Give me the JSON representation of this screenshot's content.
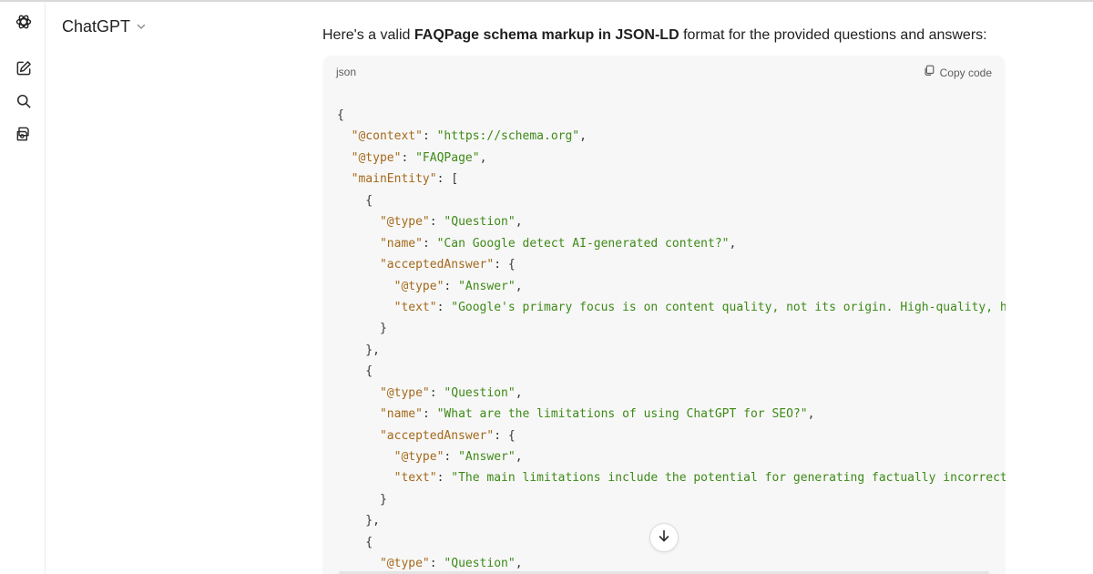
{
  "colors": {
    "key": "#a4691b",
    "string": "#3e8a17",
    "punctuation": "#383838",
    "code_background": "#f7f7f7"
  },
  "sidebar": {
    "items": [
      {
        "icon": "chatgpt-logo-icon"
      },
      {
        "icon": "new-chat-icon"
      },
      {
        "icon": "search-icon"
      },
      {
        "icon": "explore-gpts-icon"
      }
    ]
  },
  "header": {
    "model_name": "ChatGPT",
    "dropdown_icon": "chevron-down-icon"
  },
  "message": {
    "intro_prefix": "Here's a valid ",
    "intro_bold": "FAQPage schema markup in JSON-LD",
    "intro_suffix": " format for the provided questions and answers:"
  },
  "code_block": {
    "language": "json",
    "copy_label": "Copy code",
    "copy_icon": "copy-icon",
    "lines": [
      [
        [
          "p",
          "{"
        ]
      ],
      [
        [
          "p",
          "  "
        ],
        [
          "k",
          "\"@context\""
        ],
        [
          "p",
          ": "
        ],
        [
          "s",
          "\"https://schema.org\""
        ],
        [
          "p",
          ","
        ]
      ],
      [
        [
          "p",
          "  "
        ],
        [
          "k",
          "\"@type\""
        ],
        [
          "p",
          ": "
        ],
        [
          "s",
          "\"FAQPage\""
        ],
        [
          "p",
          ","
        ]
      ],
      [
        [
          "p",
          "  "
        ],
        [
          "k",
          "\"mainEntity\""
        ],
        [
          "p",
          ": ["
        ]
      ],
      [
        [
          "p",
          "    {"
        ]
      ],
      [
        [
          "p",
          "      "
        ],
        [
          "k",
          "\"@type\""
        ],
        [
          "p",
          ": "
        ],
        [
          "s",
          "\"Question\""
        ],
        [
          "p",
          ","
        ]
      ],
      [
        [
          "p",
          "      "
        ],
        [
          "k",
          "\"name\""
        ],
        [
          "p",
          ": "
        ],
        [
          "s",
          "\"Can Google detect AI-generated content?\""
        ],
        [
          "p",
          ","
        ]
      ],
      [
        [
          "p",
          "      "
        ],
        [
          "k",
          "\"acceptedAnswer\""
        ],
        [
          "p",
          ": {"
        ]
      ],
      [
        [
          "p",
          "        "
        ],
        [
          "k",
          "\"@type\""
        ],
        [
          "p",
          ": "
        ],
        [
          "s",
          "\"Answer\""
        ],
        [
          "p",
          ","
        ]
      ],
      [
        [
          "p",
          "        "
        ],
        [
          "k",
          "\"text\""
        ],
        [
          "p",
          ": "
        ],
        [
          "s",
          "\"Google's primary focus is on content quality, not its origin. High-quality, helpf"
        ]
      ],
      [
        [
          "p",
          "      }"
        ]
      ],
      [
        [
          "p",
          "    },"
        ]
      ],
      [
        [
          "p",
          "    {"
        ]
      ],
      [
        [
          "p",
          "      "
        ],
        [
          "k",
          "\"@type\""
        ],
        [
          "p",
          ": "
        ],
        [
          "s",
          "\"Question\""
        ],
        [
          "p",
          ","
        ]
      ],
      [
        [
          "p",
          "      "
        ],
        [
          "k",
          "\"name\""
        ],
        [
          "p",
          ": "
        ],
        [
          "s",
          "\"What are the limitations of using ChatGPT for SEO?\""
        ],
        [
          "p",
          ","
        ]
      ],
      [
        [
          "p",
          "      "
        ],
        [
          "k",
          "\"acceptedAnswer\""
        ],
        [
          "p",
          ": {"
        ]
      ],
      [
        [
          "p",
          "        "
        ],
        [
          "k",
          "\"@type\""
        ],
        [
          "p",
          ": "
        ],
        [
          "s",
          "\"Answer\""
        ],
        [
          "p",
          ","
        ]
      ],
      [
        [
          "p",
          "        "
        ],
        [
          "k",
          "\"text\""
        ],
        [
          "p",
          ": "
        ],
        [
          "s",
          "\"The main limitations include the potential for generating factually incorrect or"
        ]
      ],
      [
        [
          "p",
          "      }"
        ]
      ],
      [
        [
          "p",
          "    },"
        ]
      ],
      [
        [
          "p",
          "    {"
        ]
      ],
      [
        [
          "p",
          "      "
        ],
        [
          "k",
          "\"@type\""
        ],
        [
          "p",
          ": "
        ],
        [
          "s",
          "\"Question\""
        ],
        [
          "p",
          ","
        ]
      ]
    ]
  },
  "scroll_button": {
    "icon": "arrow-down-icon"
  }
}
